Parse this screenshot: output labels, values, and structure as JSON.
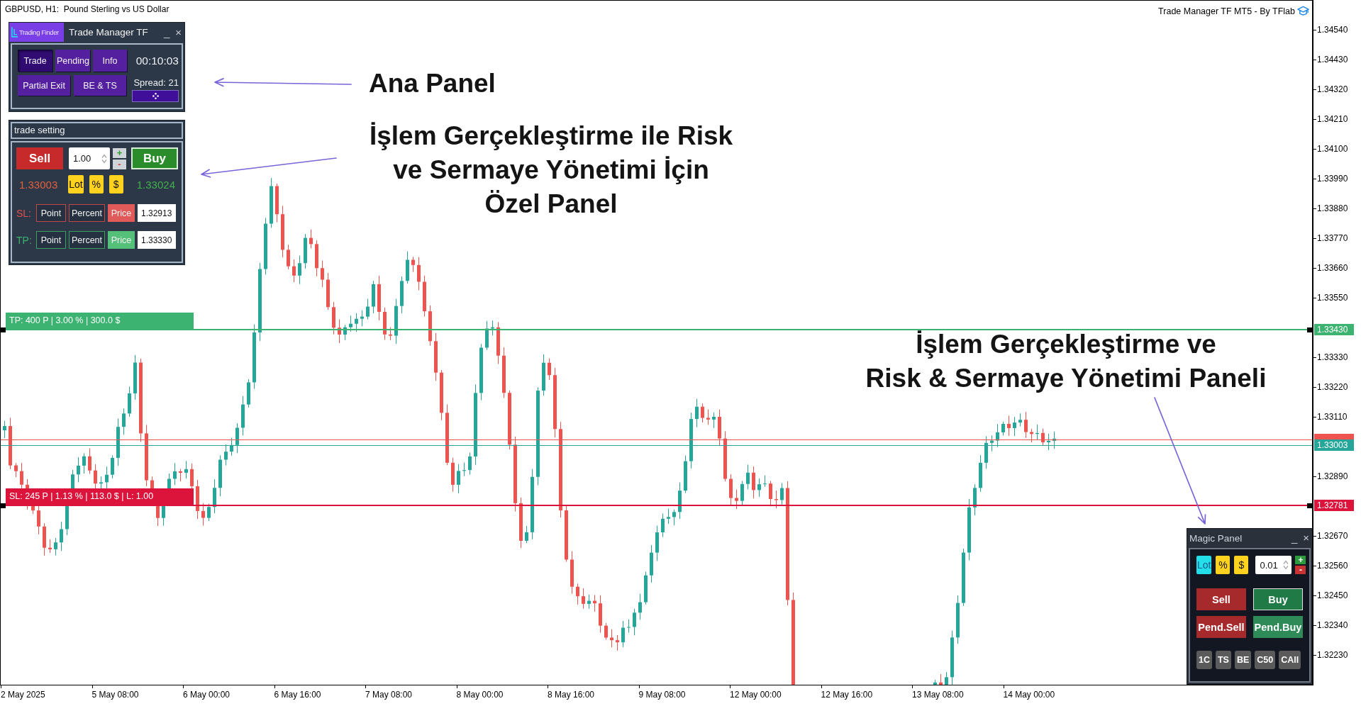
{
  "chart": {
    "title": "GBPUSD, H1:  Pound Sterling vs US Dollar",
    "expert_label": "Trade Manager TF MT5 - By TFlab",
    "levels": [
      {
        "kind": "take_profit",
        "color": "#3cb371",
        "tag": "1.33430",
        "label": "TP: 400 P | 3.00 % | 300.0 $"
      },
      {
        "kind": "ask",
        "color": "#ef5350"
      },
      {
        "kind": "bid",
        "color": "#26a69a",
        "tag": "1.33003"
      },
      {
        "kind": "stop_loss",
        "color": "#dc143c",
        "tag": "1.32781",
        "label": "SL: 245 P | 1.13 % | 113.0 $ | L: 1.00"
      }
    ],
    "price_ticks": [
      "1.34540",
      "1.34430",
      "1.34320",
      "1.34210",
      "1.34100",
      "1.33990",
      "1.33880",
      "1.33770",
      "1.33660",
      "1.33550",
      "1.33330",
      "1.33220",
      "1.33110",
      "1.32890",
      "1.32670",
      "1.32560",
      "1.32450",
      "1.32340",
      "1.32230"
    ],
    "time_labels": [
      "2 May 2025",
      "5 May 08:00",
      "6 May 00:00",
      "6 May 16:00",
      "7 May 08:00",
      "8 May 00:00",
      "8 May 16:00",
      "9 May 08:00",
      "12 May 00:00",
      "12 May 16:00",
      "13 May 08:00",
      "14 May 00:00"
    ]
  },
  "main_panel": {
    "logo": "Trading Finder",
    "title": "Trade Manager TF",
    "minimize": "_",
    "close": "×",
    "tabs": [
      {
        "label": "Trade",
        "selected": true
      },
      {
        "label": "Pending",
        "selected": false
      },
      {
        "label": "Info",
        "selected": false
      },
      {
        "label": "Partial Exit",
        "selected": false
      },
      {
        "label": "BE & TS",
        "selected": false
      }
    ],
    "timer": "00:10:03",
    "spread": "Spread: 21"
  },
  "trade_setting_panel": {
    "title": "trade setting",
    "sell": "Sell",
    "lot": "1.00",
    "plus": "+",
    "minus": "-",
    "buy": "Buy",
    "bid": "1.33003",
    "size_modes": [
      {
        "label": "Lot",
        "selected": false
      },
      {
        "label": "%",
        "selected": false
      },
      {
        "label": "$",
        "selected": false
      }
    ],
    "ask": "1.33024",
    "stop_rows": [
      {
        "kind": "sl",
        "label": "SL:",
        "modes": [
          {
            "label": "Point",
            "selected": false
          },
          {
            "label": "Percent",
            "selected": false
          },
          {
            "label": "Price",
            "selected": true
          }
        ],
        "value": "1.32913"
      },
      {
        "kind": "tp",
        "label": "TP:",
        "modes": [
          {
            "label": "Point",
            "selected": false
          },
          {
            "label": "Percent",
            "selected": false
          },
          {
            "label": "Price",
            "selected": true
          }
        ],
        "value": "1.33330"
      }
    ]
  },
  "magic_panel": {
    "title": "Magic Panel",
    "minimize": "_",
    "close": "×",
    "size_modes": [
      {
        "label": "Lot",
        "selected": true
      },
      {
        "label": "%",
        "selected": false
      },
      {
        "label": "$",
        "selected": false
      }
    ],
    "lot": "0.01",
    "plus": "+",
    "minus": "-",
    "orders": [
      {
        "kind": "sell",
        "label": "Sell"
      },
      {
        "kind": "buy",
        "label": "Buy"
      },
      {
        "kind": "pending_sell",
        "label": "Pend.Sell"
      },
      {
        "kind": "pending_buy",
        "label": "Pend.Buy"
      }
    ],
    "tools": [
      "1C",
      "TS",
      "BE",
      "C50",
      "CAll"
    ]
  },
  "annotations": [
    {
      "lines": [
        "Ana Panel"
      ]
    },
    {
      "lines": [
        "İşlem Gerçekleştirme ile Risk",
        "ve Sermaye Yönetimi İçin",
        "Özel Panel"
      ]
    },
    {
      "lines": [
        "İşlem Gerçekleştirme ve",
        "Risk & Sermaye Yönetimi Paneli"
      ]
    }
  ]
}
